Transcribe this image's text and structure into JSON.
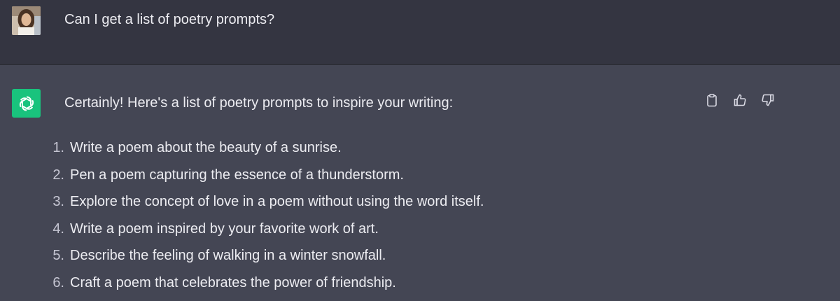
{
  "user_message": {
    "text": "Can I get a list of poetry prompts?"
  },
  "assistant_message": {
    "intro": "Certainly! Here's a list of poetry prompts to inspire your writing:",
    "items": [
      {
        "num": "1.",
        "text": "Write a poem about the beauty of a sunrise."
      },
      {
        "num": "2.",
        "text": "Pen a poem capturing the essence of a thunderstorm."
      },
      {
        "num": "3.",
        "text": "Explore the concept of love in a poem without using the word itself."
      },
      {
        "num": "4.",
        "text": "Write a poem inspired by your favorite work of art."
      },
      {
        "num": "5.",
        "text": "Describe the feeling of walking in a winter snowfall."
      },
      {
        "num": "6.",
        "text": "Craft a poem that celebrates the power of friendship."
      }
    ]
  },
  "actions": {
    "copy_icon": "clipboard-icon",
    "like_icon": "thumbs-up-icon",
    "dislike_icon": "thumbs-down-icon"
  },
  "colors": {
    "user_bg": "#343541",
    "assistant_bg": "#444654",
    "brand": "#19c37d",
    "text": "#ececf1"
  }
}
